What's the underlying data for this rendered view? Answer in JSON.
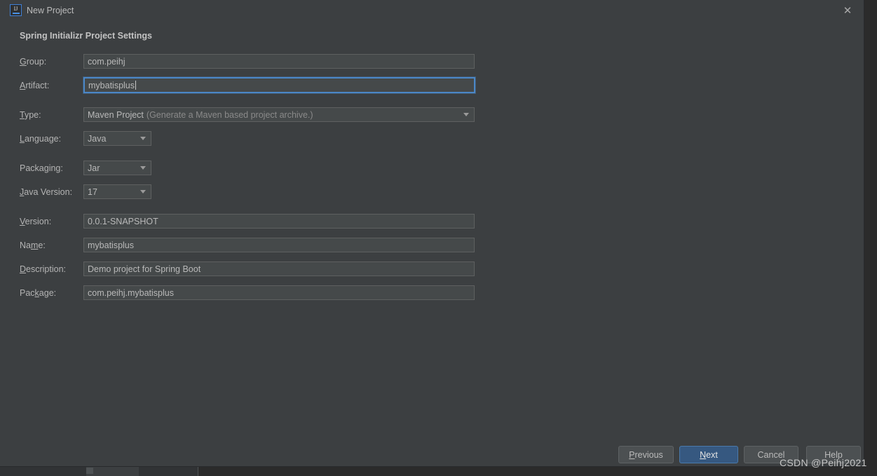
{
  "window": {
    "title": "New Project",
    "app_icon": "intellij-idea-icon",
    "icon_letters": "IJ",
    "close_icon": "✕"
  },
  "section": {
    "title": "Spring Initializr Project Settings"
  },
  "fields": [
    {
      "label": "Group:",
      "mnemonic": "G",
      "mnemonic_index": 0,
      "type": "text",
      "value": "com.peihj",
      "focused": false
    },
    {
      "label": "Artifact:",
      "mnemonic": "A",
      "mnemonic_index": 0,
      "type": "text",
      "value": "mybatisplus",
      "focused": true
    },
    {
      "label": "Type:",
      "mnemonic": "T",
      "mnemonic_index": 0,
      "type": "combo",
      "value": "Maven Project",
      "hint": "(Generate a Maven based project archive.)",
      "focused": false
    },
    {
      "label": "Language:",
      "mnemonic": "L",
      "mnemonic_index": 0,
      "type": "combo",
      "value": "Java",
      "focused": false
    },
    {
      "label": "Packaging:",
      "mnemonic": "g",
      "mnemonic_index": 6,
      "type": "combo",
      "value": "Jar",
      "focused": false
    },
    {
      "label": "Java Version:",
      "mnemonic": "J",
      "mnemonic_index": 0,
      "type": "combo",
      "value": "17",
      "focused": false
    },
    {
      "label": "Version:",
      "mnemonic": "V",
      "mnemonic_index": 0,
      "type": "text",
      "value": "0.0.1-SNAPSHOT",
      "focused": false
    },
    {
      "label": "Name:",
      "mnemonic": "m",
      "mnemonic_index": 2,
      "type": "text",
      "value": "mybatisplus",
      "focused": false
    },
    {
      "label": "Description:",
      "mnemonic": "D",
      "mnemonic_index": 0,
      "type": "text",
      "value": "Demo project for Spring Boot",
      "focused": false
    },
    {
      "label": "Package:",
      "mnemonic": "k",
      "mnemonic_index": 4,
      "type": "text",
      "value": "com.peihj.mybatisplus",
      "focused": false
    }
  ],
  "field_labels": {
    "group": "Group:",
    "artifact": "Artifact:",
    "type": "Type:",
    "language": "Language:",
    "packaging": "Packaging:",
    "java_version": "Java Version:",
    "version": "Version:",
    "name": "Name:",
    "description": "Description:",
    "package": "Package:"
  },
  "field_values": {
    "group": "com.peihj",
    "artifact": "mybatisplus",
    "type": "Maven Project",
    "type_hint": "(Generate a Maven based project archive.)",
    "language": "Java",
    "packaging": "Jar",
    "java_version": "17",
    "version": "0.0.1-SNAPSHOT",
    "name": "mybatisplus",
    "description": "Demo project for Spring Boot",
    "package": "com.peihj.mybatisplus"
  },
  "buttons": {
    "previous": "Previous",
    "next": "Next",
    "cancel": "Cancel",
    "help": "Help"
  },
  "watermark": "CSDN @Peihj2021",
  "colors": {
    "dialog_bg": "#3c3f41",
    "field_bg": "#45494a",
    "field_border": "#5e6060",
    "focus_border": "#4b87c7",
    "default_button_bg": "#365880",
    "text": "#b9b9b9",
    "hint_text": "#8a8a8a",
    "accent": "#4a90e2"
  }
}
